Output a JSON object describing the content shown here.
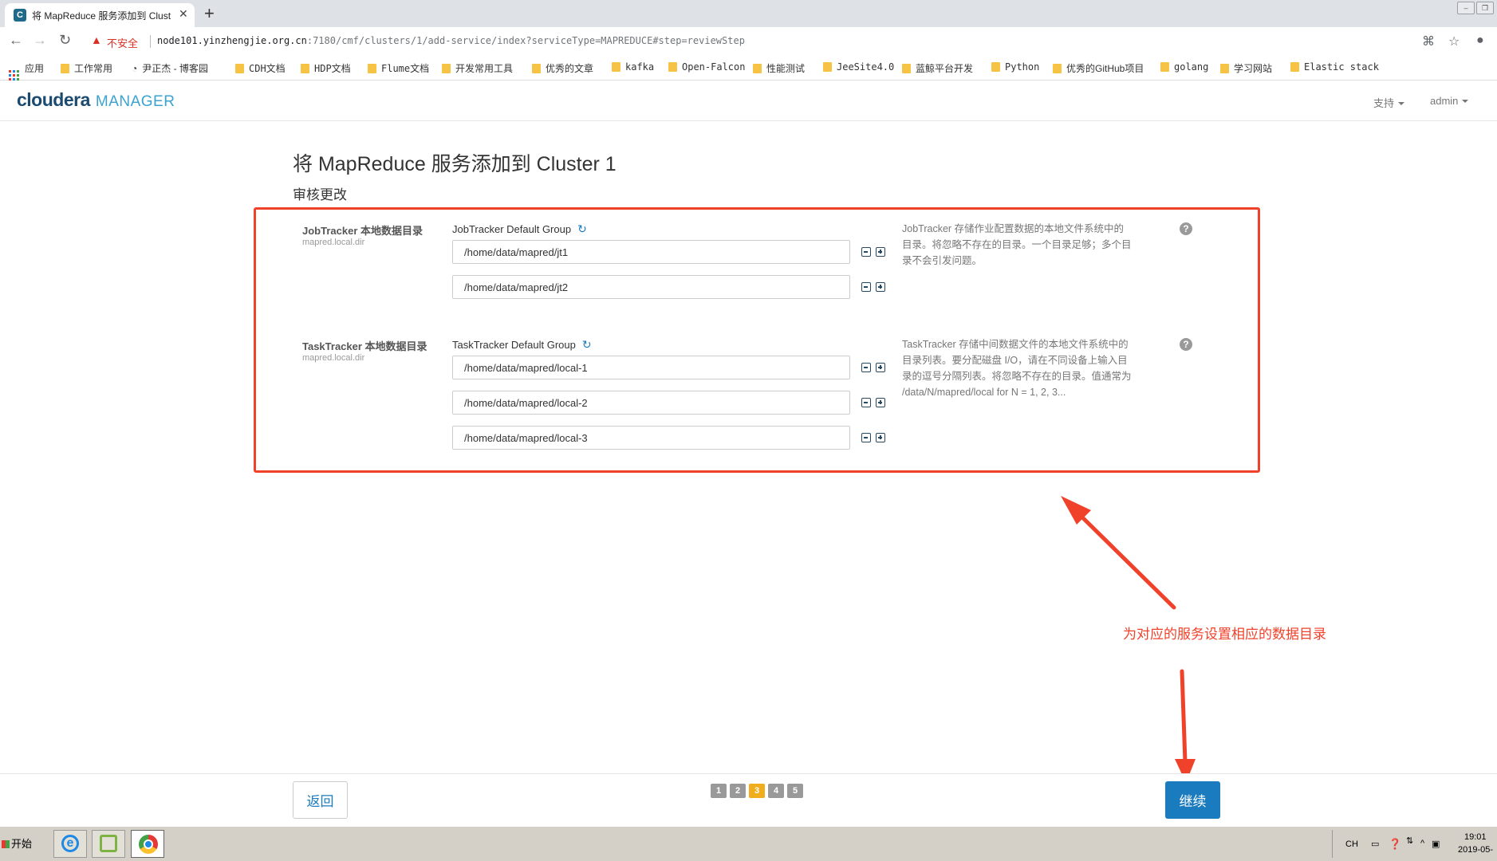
{
  "browser": {
    "tab_title": "将 MapReduce 服务添加到 Clust",
    "tab_favicon": "C",
    "insecure_label": "不安全",
    "url_host": "node101.yinzhengjie.org.cn",
    "url_path": ":7180/cmf/clusters/1/add-service/index?serviceType=MAPREDUCE#step=reviewStep"
  },
  "bookmarks": [
    {
      "label": "应用",
      "icon": "apps-grid"
    },
    {
      "label": "工作常用",
      "icon": "folder"
    },
    {
      "label": "尹正杰 - 博客园",
      "icon": "blog"
    },
    {
      "label": "CDH文档",
      "icon": "folder"
    },
    {
      "label": "HDP文档",
      "icon": "folder"
    },
    {
      "label": "Flume文档",
      "icon": "folder"
    },
    {
      "label": "开发常用工具",
      "icon": "folder"
    },
    {
      "label": "优秀的文章",
      "icon": "folder"
    },
    {
      "label": "kafka",
      "icon": "folder"
    },
    {
      "label": "Open-Falcon",
      "icon": "folder"
    },
    {
      "label": "性能测试",
      "icon": "folder"
    },
    {
      "label": "JeeSite4.0",
      "icon": "folder"
    },
    {
      "label": "蓝鲸平台开发",
      "icon": "folder"
    },
    {
      "label": "Python",
      "icon": "folder"
    },
    {
      "label": "优秀的GitHub项目",
      "icon": "folder"
    },
    {
      "label": "golang",
      "icon": "folder"
    },
    {
      "label": "学习网站",
      "icon": "folder"
    },
    {
      "label": "Elastic stack",
      "icon": "folder"
    }
  ],
  "app": {
    "logo_main": "cloudera",
    "logo_sub": "MANAGER",
    "support_menu": "支持",
    "user_menu": "admin"
  },
  "page": {
    "title": "将 MapReduce 服务添加到 Cluster 1",
    "section": "审核更改"
  },
  "jobtracker": {
    "label": "JobTracker 本地数据目录",
    "key": "mapred.local.dir",
    "group": "JobTracker Default Group",
    "values": [
      "/home/data/mapred/jt1",
      "/home/data/mapred/jt2"
    ],
    "desc_lines": [
      "JobTracker 存储作业配置数据的本地文件系统中的",
      "目录。将忽略不存在的目录。一个目录足够；多个目",
      "录不会引发问题。"
    ]
  },
  "tasktracker": {
    "label": "TaskTracker 本地数据目录",
    "key": "mapred.local.dir",
    "group": "TaskTracker Default Group",
    "values": [
      "/home/data/mapred/local-1",
      "/home/data/mapred/local-2",
      "/home/data/mapred/local-3"
    ],
    "desc_lines": [
      "TaskTracker 存储中间数据文件的本地文件系统中的",
      "目录列表。要分配磁盘 I/O，请在不同设备上输入目",
      "录的逗号分隔列表。将忽略不存在的目录。值通常为",
      "/data/N/mapred/local for N = 1, 2, 3..."
    ]
  },
  "annotation": {
    "text": "为对应的服务设置相应的数据目录",
    "color": "#f0412a"
  },
  "footer": {
    "back_label": "返回",
    "next_label": "继续",
    "steps": [
      "1",
      "2",
      "3",
      "4",
      "5"
    ],
    "current_step": "3"
  },
  "taskbar": {
    "start_label": "开始",
    "lang": "CH",
    "time": "19:01",
    "date": "2019-05-"
  },
  "colors": {
    "accent": "#1a7bbf",
    "highlight_box": "#f0412a",
    "active_step": "#f0ad1e"
  }
}
